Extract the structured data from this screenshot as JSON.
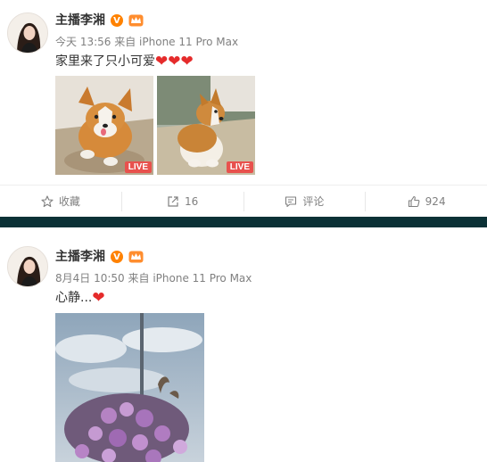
{
  "posts": [
    {
      "author": "主播李湘",
      "time": "今天 13:56",
      "source": "来自 iPhone 11 Pro Max",
      "text": "家里来了只小可爱",
      "hearts": "❤❤❤",
      "images": [
        {
          "badge": "LIVE"
        },
        {
          "badge": "LIVE"
        }
      ],
      "actions": {
        "favorite": "收藏",
        "repost": "16",
        "comment": "评论",
        "like": "924"
      }
    },
    {
      "author": "主播李湘",
      "time": "8月4日 10:50",
      "source": "来自 iPhone 11 Pro Max",
      "text": "心静...",
      "hearts": "❤"
    }
  ],
  "icons": {
    "verified": "V",
    "crown": "crown-icon"
  },
  "colors": {
    "accent": "#ff8200",
    "heart": "#e52b2b",
    "live": "#e8514d",
    "divider": "#0b3136"
  }
}
